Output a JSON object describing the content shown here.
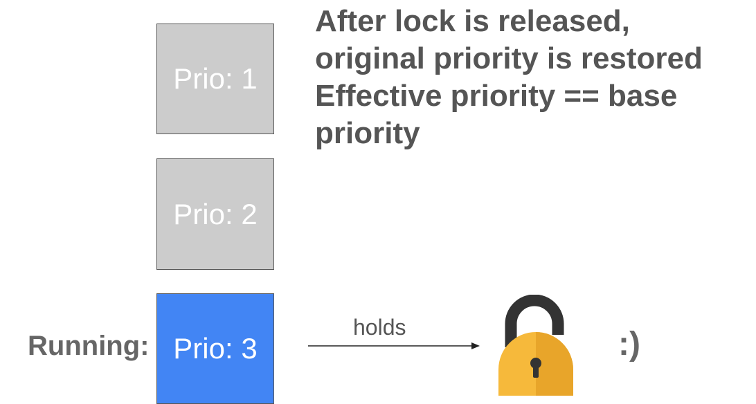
{
  "headline": {
    "lines": [
      "After lock is released,",
      "original priority is restored",
      "Effective priority == base",
      "priority"
    ]
  },
  "tasks": [
    {
      "label": "Prio: 1",
      "state": "waiting"
    },
    {
      "label": "Prio: 2",
      "state": "waiting"
    },
    {
      "label": "Prio: 3",
      "state": "running"
    }
  ],
  "running_label": "Running:",
  "relation": {
    "label": "holds"
  },
  "lock": {
    "icon": "unlocked-padlock-icon",
    "body_color": "#f6b93b",
    "shackle_color": "#333333"
  },
  "emoticon": ":)",
  "colors": {
    "waiting_box": "#cccccc",
    "running_box": "#4285f4",
    "text": "#555555"
  }
}
